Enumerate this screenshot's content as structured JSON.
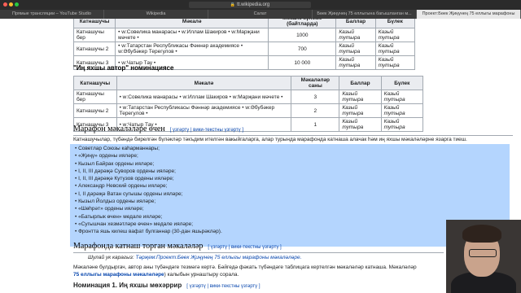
{
  "browser": {
    "url": "tt.wikipedia.org",
    "tabs": [
      "Прямые трансляции – YouTube Studio",
      "Wikipedia",
      "Салат",
      "Бөек Җиңүнең 75 еллыгына багышланган м...",
      "Проект:Бөек Җиңүнең 75 еллыгы марафоны"
    ]
  },
  "table1": {
    "columns": [
      "Катнашучы",
      "Мәкалә",
      "Мәкалә күләме (байтларда)",
      "Баллар",
      "Бүлек"
    ],
    "rows": [
      {
        "user": "Катнашучы бер",
        "articles": [
          "Совелика манарасы",
          "Иллам Шакиров",
          "Марҗани мәчете"
        ],
        "size": "1000",
        "score": "Казый тутыра",
        "section": "Казый тутыра"
      },
      {
        "user": "Катнашучы 2",
        "articles": [
          "Татарстан Республикасы Фәннәр академиясе",
          "Әбубәкер Терегулов"
        ],
        "size": "700",
        "score": "Казый тутыра",
        "section": "Казый тутыра"
      },
      {
        "user": "Катнашучы 3",
        "articles": [
          "Чатыр Тау"
        ],
        "size": "10 000",
        "score": "Казый тутыра",
        "section": "Казый тутыра"
      }
    ]
  },
  "nomination2": "\"Иң яхшы автор\" номинациясе",
  "table2": {
    "columns": [
      "Катнашучы",
      "Мәкалә",
      "Мәкаләләр саны",
      "Баллар",
      "Бүлек"
    ],
    "rows": [
      {
        "user": "Катнашучы бер",
        "articles": [
          "Совелика манарасы",
          "Иллам Шакиров",
          "Марҗани мәчете"
        ],
        "count": "3",
        "score": "Казый тутыра",
        "section": "Казый тутыра"
      },
      {
        "user": "Катнашучы 2",
        "articles": [
          "Татарстан Республикасы Фәннәр академиясе",
          "Әбубәкер Терегулов"
        ],
        "count": "2",
        "score": "Казый тутыра",
        "section": "Казый тутыра"
      },
      {
        "user": "Катнашучы 3",
        "articles": [
          "Чатыр Тау"
        ],
        "count": "1",
        "score": "Казый тутыра",
        "section": "Казый тутыра"
      }
    ]
  },
  "section1": {
    "title": "Марафон мәкаләләре өчен",
    "edit": "[ үзгәртү | вики-текстны үзгәртү ]",
    "intro": "Катнашучылар, түбәндә бирелгән бүләкләр тәкъдим ителгән вакыйгаларга, алар турында марафонда катнаша алачак һәм иң яхшы мәкаләләрне язарга тиеш.",
    "awards": [
      "Советлар Союзы каһарманнары;",
      "«Җиңү» ордены ияләре;",
      "Кызыл Байрак ордены ияләре;",
      "I, II, III дәрәҗә Суворов ордены ияләре;",
      "I, II, III дәрәҗә Кутузов ордены ияләре;",
      "Александр Невский ордены ияләре;",
      "I, II дәрәҗә Ватан сугышы ордены ияләре;",
      "Кызыл Йолдыз ордены ияләре;",
      "«Шөһрәт» ордены ияләре;",
      "«Батырлык өчен» медале ияләре;",
      "«Сугышчан хезмәтләре өчен» медале ияләре;"
    ],
    "last": "Фронтта яшь килеш вафат булганнар (30-дан яшьрәкләр)."
  },
  "section2": {
    "title": "Марафонда катнаш торган мәкаләләр",
    "edit": "[ үзгәртү | вики-текстны үзгәртү ]",
    "hatnote_prefix": "Шулай ук карагыз:",
    "hatnote_link": "Тәрҗем:Проект:Бөек Җиңүнең 75 еллыгы марафоны мәкаләләре.",
    "para": "Мәкаләне булдыргач, автор аны түбәндәге тезмәгә кертә. Бәйгедә фәкать түбәндәге таблицага кертелгән мәкаләләр катнаша. Мәкаләләр",
    "para2_link": "75 еллыгы марафоны мәкаләләре",
    "para2": ") калыбын урнаштыру сорала."
  },
  "section3": {
    "title": "Номинация 1. Иң яхшы мөхәррир",
    "edit": "[ үзгәртү | вики-текстны үзгәртү ]"
  }
}
